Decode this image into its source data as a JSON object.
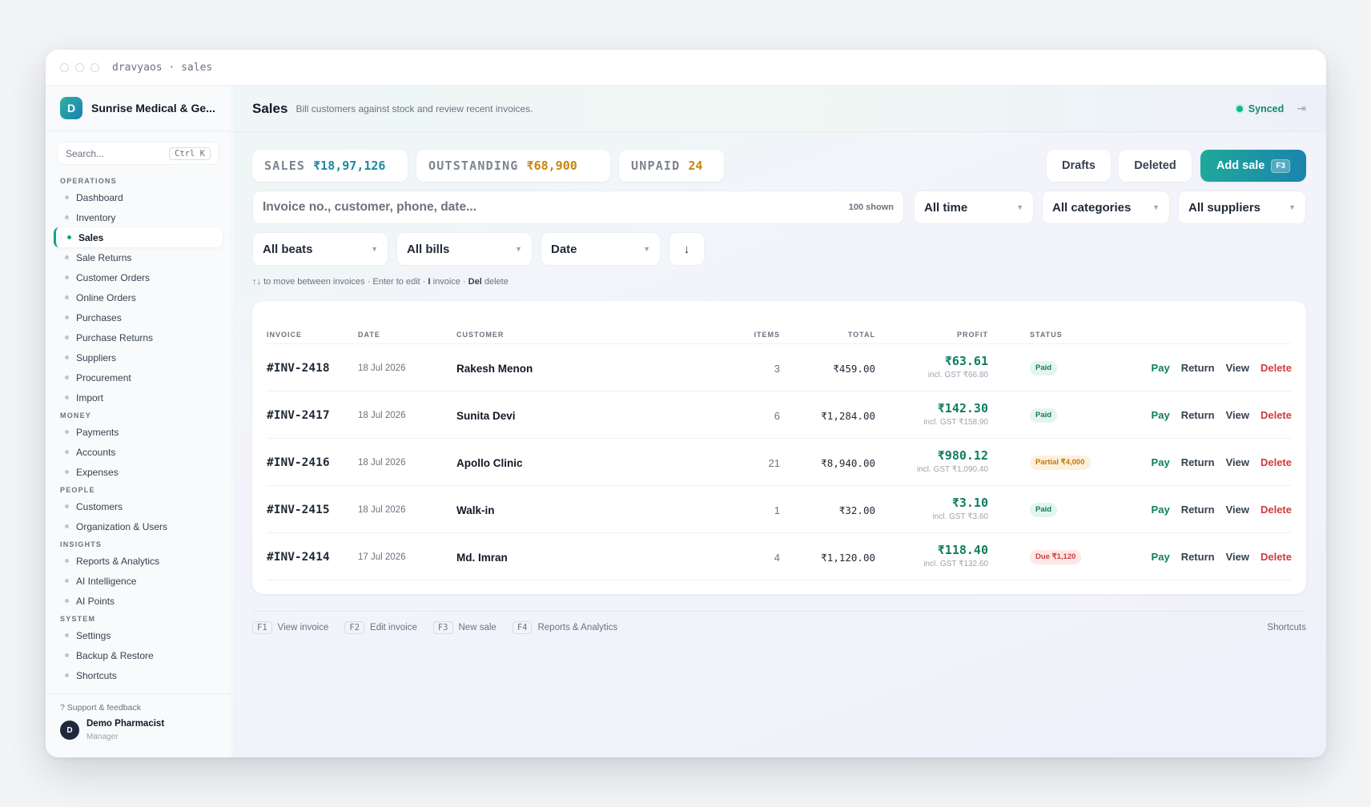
{
  "window": {
    "title": "dravyaos · sales"
  },
  "sidebar": {
    "brand_initial": "D",
    "brand_name": "Sunrise Medical & Ge...",
    "search_placeholder": "Search...",
    "search_shortcut": "Ctrl K",
    "groups": [
      {
        "label": "OPERATIONS",
        "items": [
          "Dashboard",
          "Inventory",
          "Sales",
          "Sale Returns",
          "Customer Orders",
          "Online Orders",
          "Purchases",
          "Purchase Returns",
          "Suppliers",
          "Procurement",
          "Import"
        ]
      },
      {
        "label": "MONEY",
        "items": [
          "Payments",
          "Accounts",
          "Expenses"
        ]
      },
      {
        "label": "PEOPLE",
        "items": [
          "Customers",
          "Organization & Users"
        ]
      },
      {
        "label": "INSIGHTS",
        "items": [
          "Reports & Analytics",
          "AI Intelligence",
          "AI Points"
        ]
      },
      {
        "label": "SYSTEM",
        "items": [
          "Settings",
          "Backup & Restore",
          "Shortcuts"
        ]
      }
    ],
    "active_item": "Sales",
    "support": "? Support & feedback",
    "user": {
      "initial": "D",
      "name": "Demo Pharmacist",
      "role": "Manager"
    }
  },
  "header": {
    "title": "Sales",
    "subtitle": "Bill customers against stock and review recent invoices.",
    "sync_status": "Synced"
  },
  "stats": {
    "sales": {
      "label": "SALES",
      "value": "₹18,97,126",
      "color": "#1a8aa0"
    },
    "outstanding": {
      "label": "OUTSTANDING",
      "value": "₹68,900",
      "color": "#c9860b"
    },
    "unpaid": {
      "label": "UNPAID",
      "value": "24",
      "color": "#c9860b"
    }
  },
  "actions": {
    "drafts": "Drafts",
    "deleted": "Deleted",
    "add_sale": "Add sale",
    "add_sale_key": "F3"
  },
  "filters": {
    "search_placeholder": "Invoice no., customer, phone, date...",
    "shown": "100 shown",
    "time": "All time",
    "categories": "All categories",
    "suppliers": "All suppliers",
    "beats": "All beats",
    "bills": "All bills",
    "sort": "Date",
    "sort_dir": "↓"
  },
  "hint": {
    "keys": "↑↓",
    "t1": "to move between invoices · Enter to edit ·",
    "k2": "I",
    "t2": "invoice ·",
    "k3": "Del",
    "t3": "delete"
  },
  "table": {
    "columns": {
      "invoice": "INVOICE",
      "date": "DATE",
      "customer": "CUSTOMER",
      "items": "ITEMS",
      "total": "TOTAL",
      "profit": "PROFIT",
      "status": "STATUS"
    },
    "actions": {
      "pay": "Pay",
      "return": "Return",
      "view": "View",
      "delete": "Delete"
    },
    "rows": [
      {
        "invoice": "#INV-2418",
        "date": "18 Jul 2026",
        "customer": "Rakesh Menon",
        "items": "3",
        "total": "₹459.00",
        "profit": "₹63.61",
        "gst": "incl. GST ₹66.80",
        "status": "Paid",
        "status_type": "paid"
      },
      {
        "invoice": "#INV-2417",
        "date": "18 Jul 2026",
        "customer": "Sunita Devi",
        "items": "6",
        "total": "₹1,284.00",
        "profit": "₹142.30",
        "gst": "incl. GST ₹158.90",
        "status": "Paid",
        "status_type": "paid"
      },
      {
        "invoice": "#INV-2416",
        "date": "18 Jul 2026",
        "customer": "Apollo Clinic",
        "items": "21",
        "total": "₹8,940.00",
        "profit": "₹980.12",
        "gst": "incl. GST ₹1,090.40",
        "status": "Partial ₹4,000",
        "status_type": "part"
      },
      {
        "invoice": "#INV-2415",
        "date": "18 Jul 2026",
        "customer": "Walk-in",
        "items": "1",
        "total": "₹32.00",
        "profit": "₹3.10",
        "gst": "incl. GST ₹3.60",
        "status": "Paid",
        "status_type": "paid"
      },
      {
        "invoice": "#INV-2414",
        "date": "17 Jul 2026",
        "customer": "Md. Imran",
        "items": "4",
        "total": "₹1,120.00",
        "profit": "₹118.40",
        "gst": "incl. GST ₹132.60",
        "status": "Due ₹1,120",
        "status_type": "due"
      }
    ]
  },
  "footer": {
    "shortcuts": [
      {
        "key": "F1",
        "label": "View invoice"
      },
      {
        "key": "F2",
        "label": "Edit invoice"
      },
      {
        "key": "F3",
        "label": "New sale"
      },
      {
        "key": "F4",
        "label": "Reports & Analytics"
      }
    ],
    "link": "Shortcuts"
  }
}
